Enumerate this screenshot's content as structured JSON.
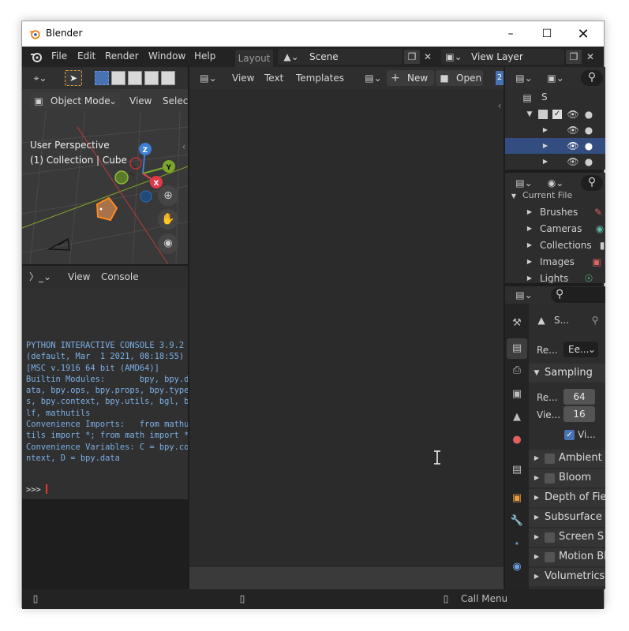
{
  "window": {
    "title": "Blender"
  },
  "menu": {
    "file": "File",
    "edit": "Edit",
    "render": "Render",
    "window": "Window",
    "help": "Help"
  },
  "workspace_tab": "Layout",
  "scene": {
    "name": "Scene"
  },
  "view_layer": {
    "name": "View Layer"
  },
  "viewport": {
    "mode": "Object Mode",
    "menu_view": "View",
    "menu_select": "Select",
    "overlay_line1": "User Perspective",
    "overlay_line2": "(1) Collection | Cube",
    "gizmo": {
      "z": "Z",
      "y": "Y",
      "x": "X"
    }
  },
  "console": {
    "menu_view": "View",
    "menu_console": "Console",
    "lines": [
      "PYTHON INTERACTIVE CONSOLE 3.9.2",
      "(default, Mar  1 2021, 08:18:55)",
      "[MSC v.1916 64 bit (AMD64)]",
      "",
      "Builtin Modules:       bpy, bpy.d",
      "ata, bpy.ops, bpy.props, bpy.type",
      "s, bpy.context, bpy.utils, bgl, b",
      "lf, mathutils",
      "Convenience Imports:   from mathu",
      "tils import *; from math import *",
      "Convenience Variables: C = bpy.co",
      "ntext, D = bpy.data"
    ],
    "prompt": ">>>"
  },
  "text_editor": {
    "menu_view": "View",
    "menu_text": "Text",
    "menu_templates": "Templates",
    "new_label": "New",
    "open_label": "Open",
    "extra_tab": "2"
  },
  "outliner": {
    "scene_label": "S",
    "rows": 4
  },
  "file_browser": {
    "root": "Current File",
    "items": [
      "Brushes",
      "Cameras",
      "Collections",
      "Images",
      "Lights"
    ]
  },
  "properties": {
    "scene_short": "S...",
    "render_engine_label": "Re...",
    "render_engine_value": "Ee...",
    "sampling_label": "Sampling",
    "render_samples_label": "Re...",
    "render_samples_value": "64",
    "viewport_samples_label": "Vie...",
    "viewport_samples_value": "16",
    "viewport_denoise_label": "Vi...",
    "panels": [
      "Ambient",
      "Bloom",
      "Depth of Field",
      "Subsurface",
      "Screen S",
      "Motion Bl",
      "Volumetrics"
    ],
    "panels_with_checkbox": [
      true,
      true,
      false,
      false,
      true,
      true,
      false
    ]
  },
  "status": {
    "call_menu": "Call Menu"
  },
  "colors": {
    "accent_blue": "#4772b3",
    "selected_row": "#334d80",
    "cursor_red": "#e53935"
  }
}
